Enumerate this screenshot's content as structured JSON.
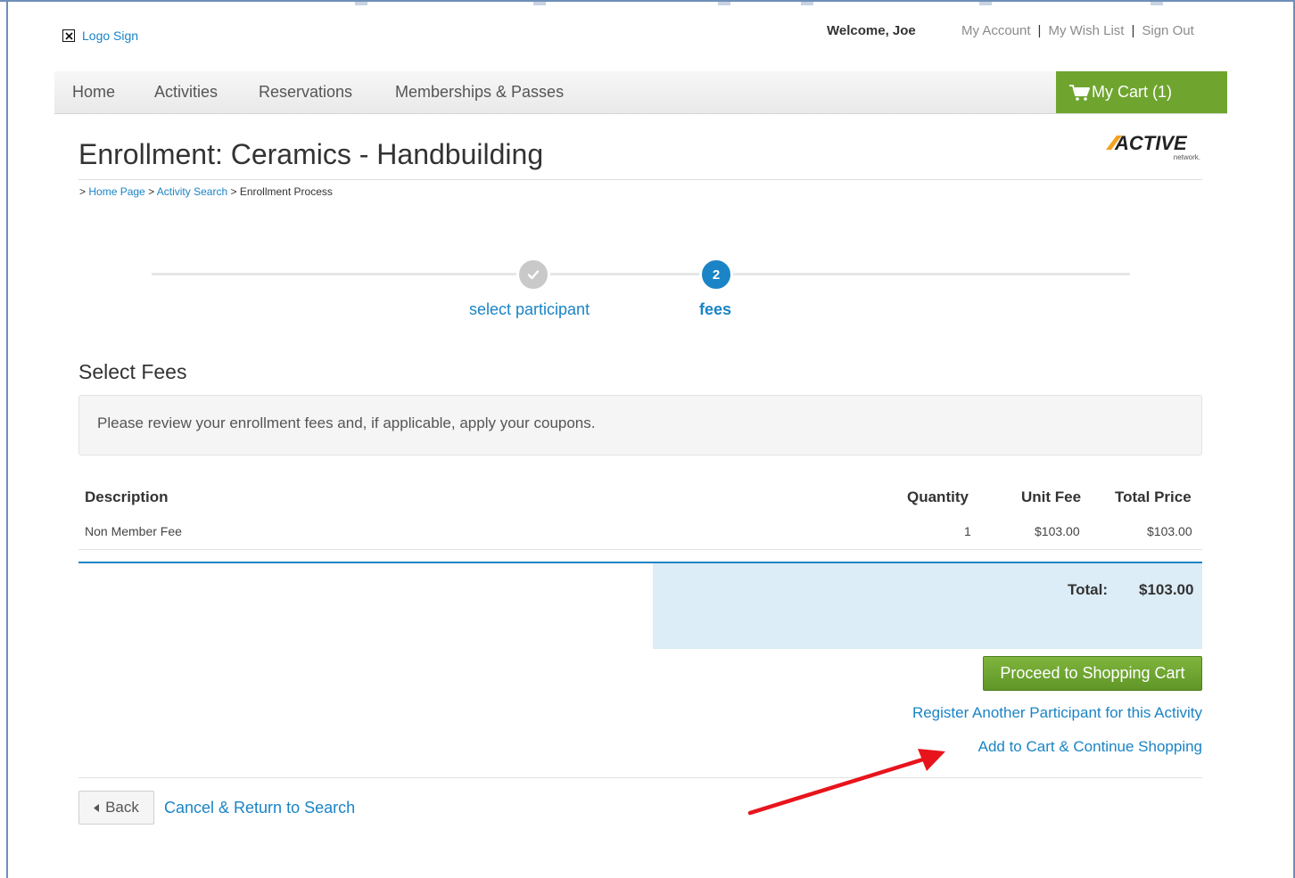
{
  "header": {
    "logo_text": "Logo Sign",
    "welcome": "Welcome, Joe",
    "links": [
      "My Account",
      "My Wish List",
      "Sign Out"
    ]
  },
  "nav": {
    "items": [
      "Home",
      "Activities",
      "Reservations",
      "Memberships & Passes"
    ],
    "cart_label": "My Cart (1)"
  },
  "page": {
    "title": "Enrollment: Ceramics - Handbuilding",
    "brand_logo": "ACTIVE",
    "brand_sub": "network.",
    "breadcrumb": {
      "prefix": ">",
      "home": "Home Page",
      "sep": ">",
      "search": "Activity Search",
      "sep2": ">",
      "current": "Enrollment Process"
    }
  },
  "steps": [
    {
      "label": "select participant",
      "state": "complete"
    },
    {
      "number": "2",
      "label": "fees",
      "state": "current"
    }
  ],
  "fees": {
    "section_title": "Select Fees",
    "notice": "Please review your enrollment fees and, if applicable, apply your coupons.",
    "columns": [
      "Description",
      "Quantity",
      "Unit Fee",
      "Total Price"
    ],
    "rows": [
      {
        "description": "Non Member Fee",
        "quantity": "1",
        "unit_fee": "$103.00",
        "total": "$103.00"
      }
    ],
    "total_label": "Total:",
    "total_value": "$103.00"
  },
  "actions": {
    "proceed": "Proceed to Shopping Cart",
    "register_another": "Register Another Participant for this Activity",
    "add_continue": "Add to Cart & Continue Shopping",
    "back": "Back",
    "cancel": "Cancel & Return to Search"
  },
  "colors": {
    "link": "#1a84c6",
    "cart_green": "#6fa52f",
    "total_bg": "#dcedf7",
    "annotation_arrow": "#e8141c"
  }
}
